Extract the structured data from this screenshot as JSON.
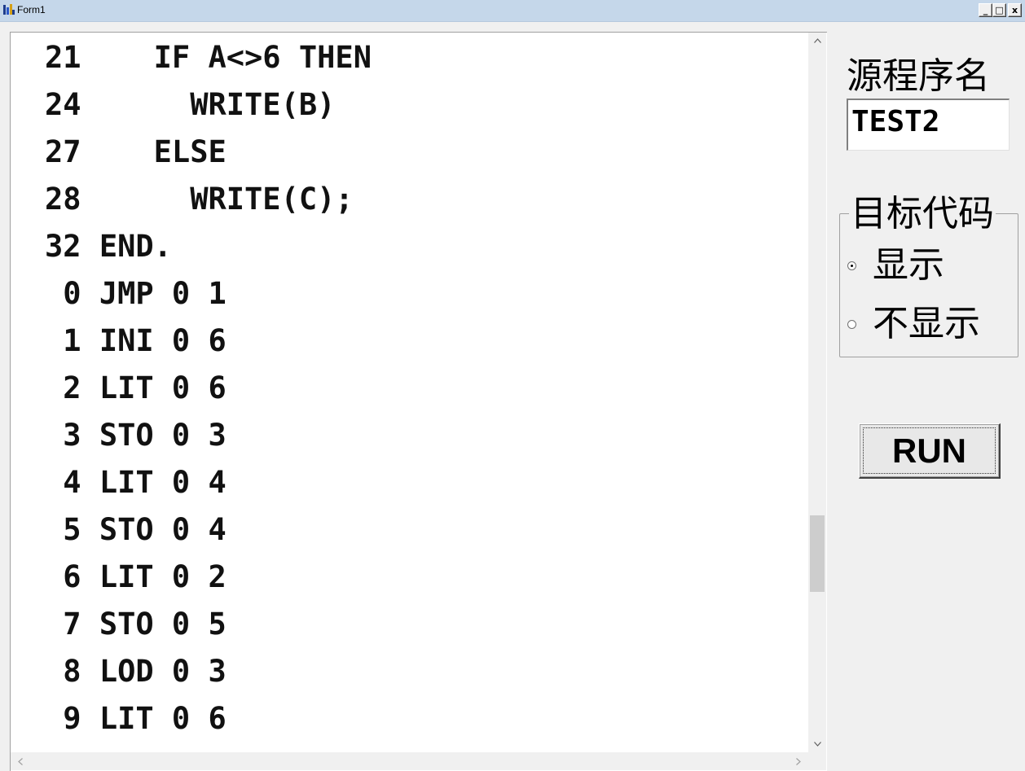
{
  "window": {
    "title": "Form1",
    "minimize_label": "_",
    "maximize_label": "□",
    "close_label": "x"
  },
  "editor": {
    "lines": [
      "21    IF A<>6 THEN",
      "24      WRITE(B)",
      "27    ELSE",
      "28      WRITE(C);",
      "32 END.",
      " 0 JMP 0 1",
      " 1 INI 0 6",
      " 2 LIT 0 6",
      " 3 STO 0 3",
      " 4 LIT 0 4",
      " 5 STO 0 4",
      " 6 LIT 0 2",
      " 7 STO 0 5",
      " 8 LOD 0 3",
      " 9 LIT 0 6"
    ],
    "scroll_up_icon": "chevron-up-icon",
    "scroll_down_icon": "chevron-down-icon",
    "scroll_left_icon": "chevron-left-icon",
    "scroll_right_icon": "chevron-right-icon"
  },
  "source": {
    "label": "源程序名",
    "value": "TEST2"
  },
  "target_code": {
    "title": "目标代码",
    "options": [
      {
        "label": "显示",
        "selected": true
      },
      {
        "label": "不显示",
        "selected": false
      }
    ]
  },
  "run_button": {
    "label": "RUN"
  }
}
